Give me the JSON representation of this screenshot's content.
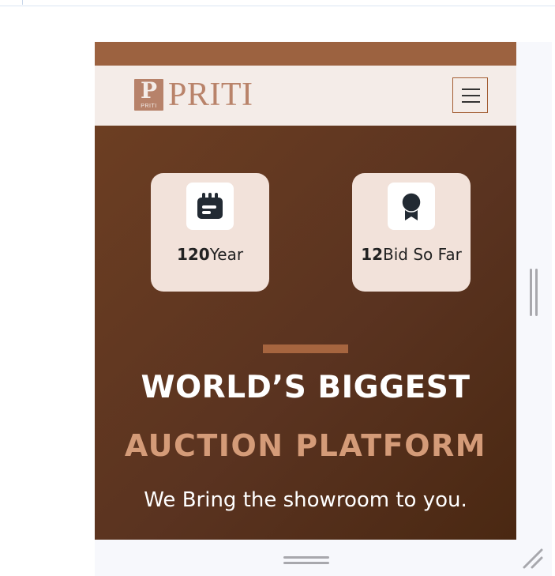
{
  "brand": {
    "logo_mark_letter": "P",
    "logo_mark_small": "PRITI",
    "name": "PRITI"
  },
  "nav": {
    "menu_icon": "hamburger-menu-icon"
  },
  "stats": [
    {
      "value": "120",
      "label": "Year",
      "icon": "calendar-icon"
    },
    {
      "value": "12",
      "label": "Bid So Far",
      "icon": "award-ribbon-icon"
    }
  ],
  "hero": {
    "headline_line1": "WORLD’S BIGGEST",
    "headline_line2": "AUCTION PLATFORM",
    "tagline": "We Bring the showroom to you."
  },
  "colors": {
    "topbar": "#9c6240",
    "navbar_bg": "#f4ece8",
    "hero_bg": "#5a3320",
    "accent": "#d49b78",
    "card_bg": "#f2e2da"
  }
}
